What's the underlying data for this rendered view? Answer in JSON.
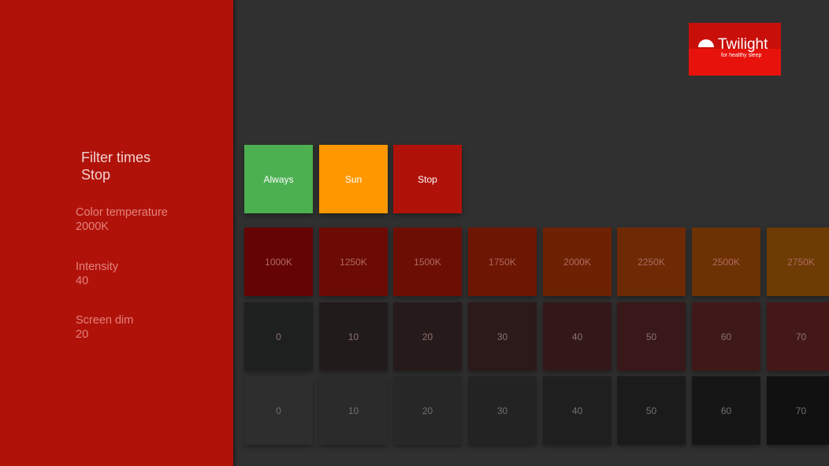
{
  "sidebar": {
    "heading_title": "Filter times",
    "heading_value": "Stop",
    "settings": [
      {
        "label": "Color temperature",
        "value": "2000K"
      },
      {
        "label": "Intensity",
        "value": "40"
      },
      {
        "label": "Screen dim",
        "value": "20"
      }
    ]
  },
  "logo": {
    "name": "Twilight",
    "tagline": "for healthy sleep"
  },
  "modes": [
    {
      "label": "Always",
      "color": "#4caf50"
    },
    {
      "label": "Sun",
      "color": "#ff9800"
    },
    {
      "label": "Stop",
      "color": "#b0120a"
    }
  ],
  "color_temperatures": [
    {
      "label": "1000K",
      "color": "#650404"
    },
    {
      "label": "1250K",
      "color": "#6c0a04"
    },
    {
      "label": "1500K",
      "color": "#6d0e04"
    },
    {
      "label": "1750K",
      "color": "#6d1604"
    },
    {
      "label": "2000K",
      "color": "#6e2204"
    },
    {
      "label": "2250K",
      "color": "#6d2a04"
    },
    {
      "label": "2500K",
      "color": "#6d3204"
    },
    {
      "label": "2750K",
      "color": "#6d3b04"
    }
  ],
  "intensities": [
    {
      "label": "0",
      "color": "#1e1f1f"
    },
    {
      "label": "10",
      "color": "#221b1b"
    },
    {
      "label": "20",
      "color": "#271a1a"
    },
    {
      "label": "30",
      "color": "#2c1919"
    },
    {
      "label": "40",
      "color": "#321819"
    },
    {
      "label": "50",
      "color": "#381818"
    },
    {
      "label": "60",
      "color": "#3f1919"
    },
    {
      "label": "70",
      "color": "#451818"
    }
  ],
  "screen_dims": [
    {
      "label": "0",
      "color": "#2e2e2e"
    },
    {
      "label": "10",
      "color": "#2b2b2b"
    },
    {
      "label": "20",
      "color": "#272727"
    },
    {
      "label": "30",
      "color": "#232323"
    },
    {
      "label": "40",
      "color": "#1f1f1f"
    },
    {
      "label": "50",
      "color": "#1b1b1b"
    },
    {
      "label": "60",
      "color": "#161616"
    },
    {
      "label": "70",
      "color": "#111111"
    }
  ]
}
